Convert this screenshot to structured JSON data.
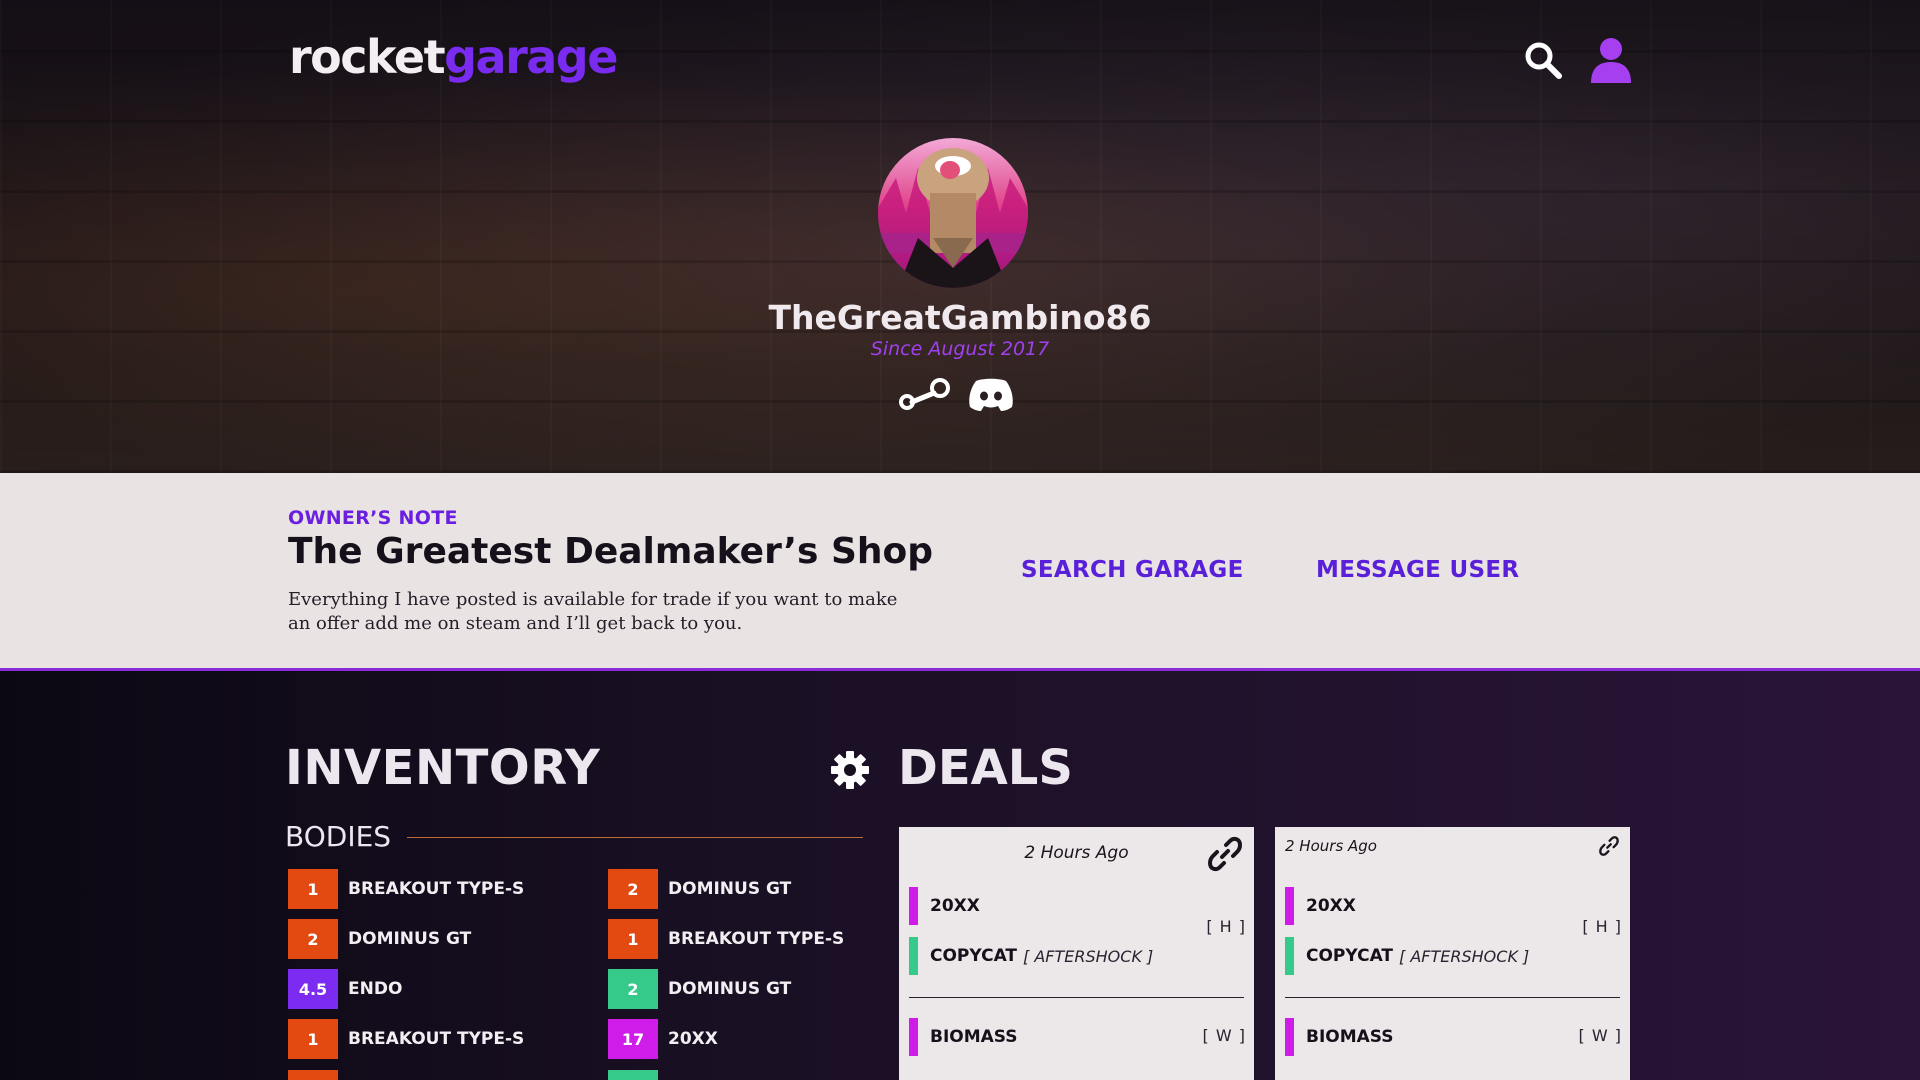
{
  "brand": {
    "logo_part1": "rocket",
    "logo_part2": "garage"
  },
  "header": {
    "icons": [
      "search-icon",
      "user-icon"
    ]
  },
  "profile": {
    "username": "TheGreatGambino86",
    "since": "Since August 2017",
    "socials": [
      "steam-icon",
      "discord-icon"
    ]
  },
  "owner_note": {
    "label": "OWNER’S NOTE",
    "title": "The Greatest Dealmaker’s Shop",
    "text": "Everything I have posted is available for trade if you want to make an offer add me on steam and I’ll get back to you.",
    "search_garage": "SEARCH GARAGE",
    "message_user": "MESSAGE USER"
  },
  "inventory": {
    "title": "INVENTORY",
    "section": "BODIES",
    "items": [
      {
        "qty": "1",
        "name": "BREAKOUT TYPE-S",
        "color": "#e24a12"
      },
      {
        "qty": "2",
        "name": "DOMINUS GT",
        "color": "#e24a12"
      },
      {
        "qty": "2",
        "name": "DOMINUS GT",
        "color": "#e24a12"
      },
      {
        "qty": "1",
        "name": "BREAKOUT TYPE-S",
        "color": "#e24a12"
      },
      {
        "qty": "4.5",
        "name": "ENDO",
        "color": "#7b2cf0"
      },
      {
        "qty": "2",
        "name": "DOMINUS GT",
        "color": "#35c98a"
      },
      {
        "qty": "1",
        "name": "BREAKOUT TYPE-S",
        "color": "#e24a12"
      },
      {
        "qty": "17",
        "name": "20XX",
        "color": "#d01ce8"
      }
    ]
  },
  "deals": {
    "title": "DEALS",
    "cards": [
      {
        "time": "2 Hours Ago",
        "have_items": [
          {
            "name": "20XX",
            "sub": "",
            "color": "#d01ce8"
          },
          {
            "name": "COPYCAT",
            "sub": "[ AFTERSHOCK ]",
            "color": "#35c98a"
          }
        ],
        "have_tag": "[ H ]",
        "want_items": [
          {
            "name": "BIOMASS",
            "sub": "",
            "color": "#d01ce8"
          }
        ],
        "want_tag": "[ W ]"
      },
      {
        "time": "2 Hours Ago",
        "have_items": [
          {
            "name": "20XX",
            "sub": "",
            "color": "#d01ce8"
          },
          {
            "name": "COPYCAT",
            "sub": "[ AFTERSHOCK ]",
            "color": "#35c98a"
          }
        ],
        "have_tag": "[ H ]",
        "want_items": [
          {
            "name": "BIOMASS",
            "sub": "",
            "color": "#d01ce8"
          }
        ],
        "want_tag": "[ W ]"
      }
    ]
  },
  "colors": {
    "accent_purple": "#7a2bf0",
    "link_purple": "#5a1fd8",
    "orange": "#e24a12",
    "green": "#35c98a",
    "magenta": "#d01ce8"
  }
}
